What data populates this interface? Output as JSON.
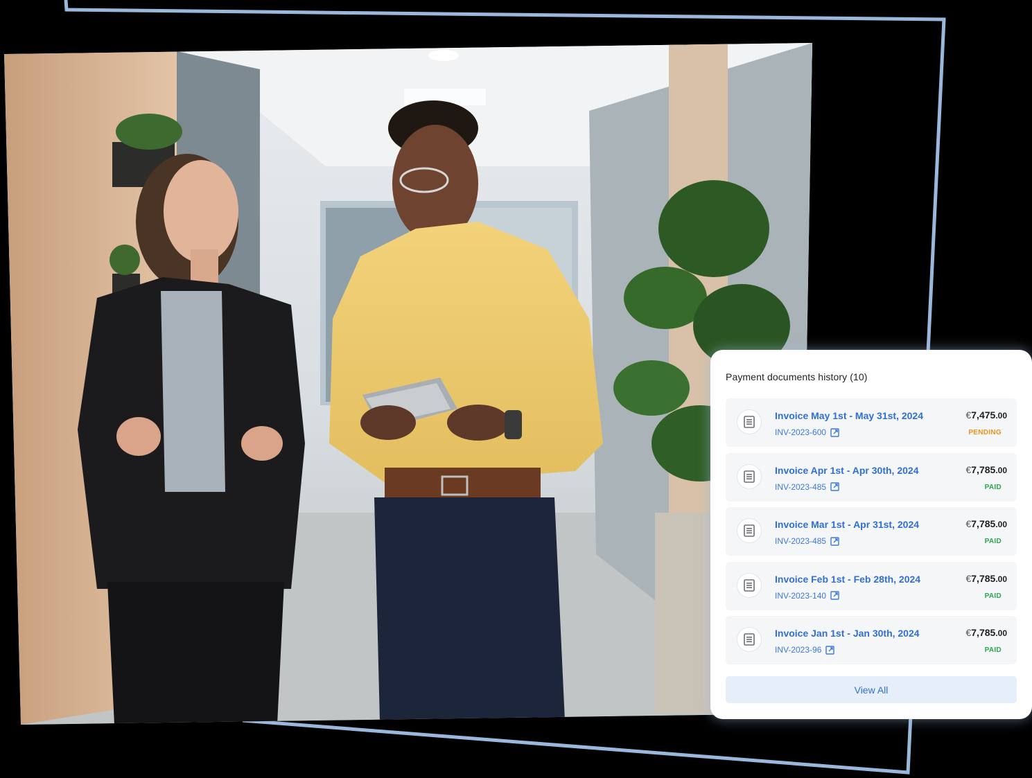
{
  "card": {
    "title": "Payment documents history (10)",
    "view_all_label": "View All",
    "invoices": [
      {
        "title": "Invoice May 1st - May 31st, 2024",
        "ref": "INV-2023-600",
        "currency": "€",
        "amount_int": "7,475",
        "amount_dec": ".00",
        "status": "PENDING",
        "status_color": "#f0901a"
      },
      {
        "title": "Invoice Apr 1st - Apr 30th, 2024",
        "ref": "INV-2023-485",
        "currency": "€",
        "amount_int": "7,785",
        "amount_dec": ".00",
        "status": "PAID",
        "status_color": "#2aa84a"
      },
      {
        "title": "Invoice Mar 1st - Apr 31st, 2024",
        "ref": "INV-2023-485",
        "currency": "€",
        "amount_int": "7,785",
        "amount_dec": ".00",
        "status": "PAID",
        "status_color": "#2aa84a"
      },
      {
        "title": "Invoice Feb 1st - Feb 28th, 2024",
        "ref": "INV-2023-140",
        "currency": "€",
        "amount_int": "7,785",
        "amount_dec": ".00",
        "status": "PAID",
        "status_color": "#2aa84a"
      },
      {
        "title": "Invoice Jan 1st - Jan 30th, 2024",
        "ref": "INV-2023-96",
        "currency": "€",
        "amount_int": "7,785",
        "amount_dec": ".00",
        "status": "PAID",
        "status_color": "#2aa84a"
      }
    ]
  },
  "colors": {
    "frame": "#9ab8dc",
    "accent": "#2f6fd6"
  },
  "icons": [
    "document-icon",
    "external-link-icon"
  ]
}
